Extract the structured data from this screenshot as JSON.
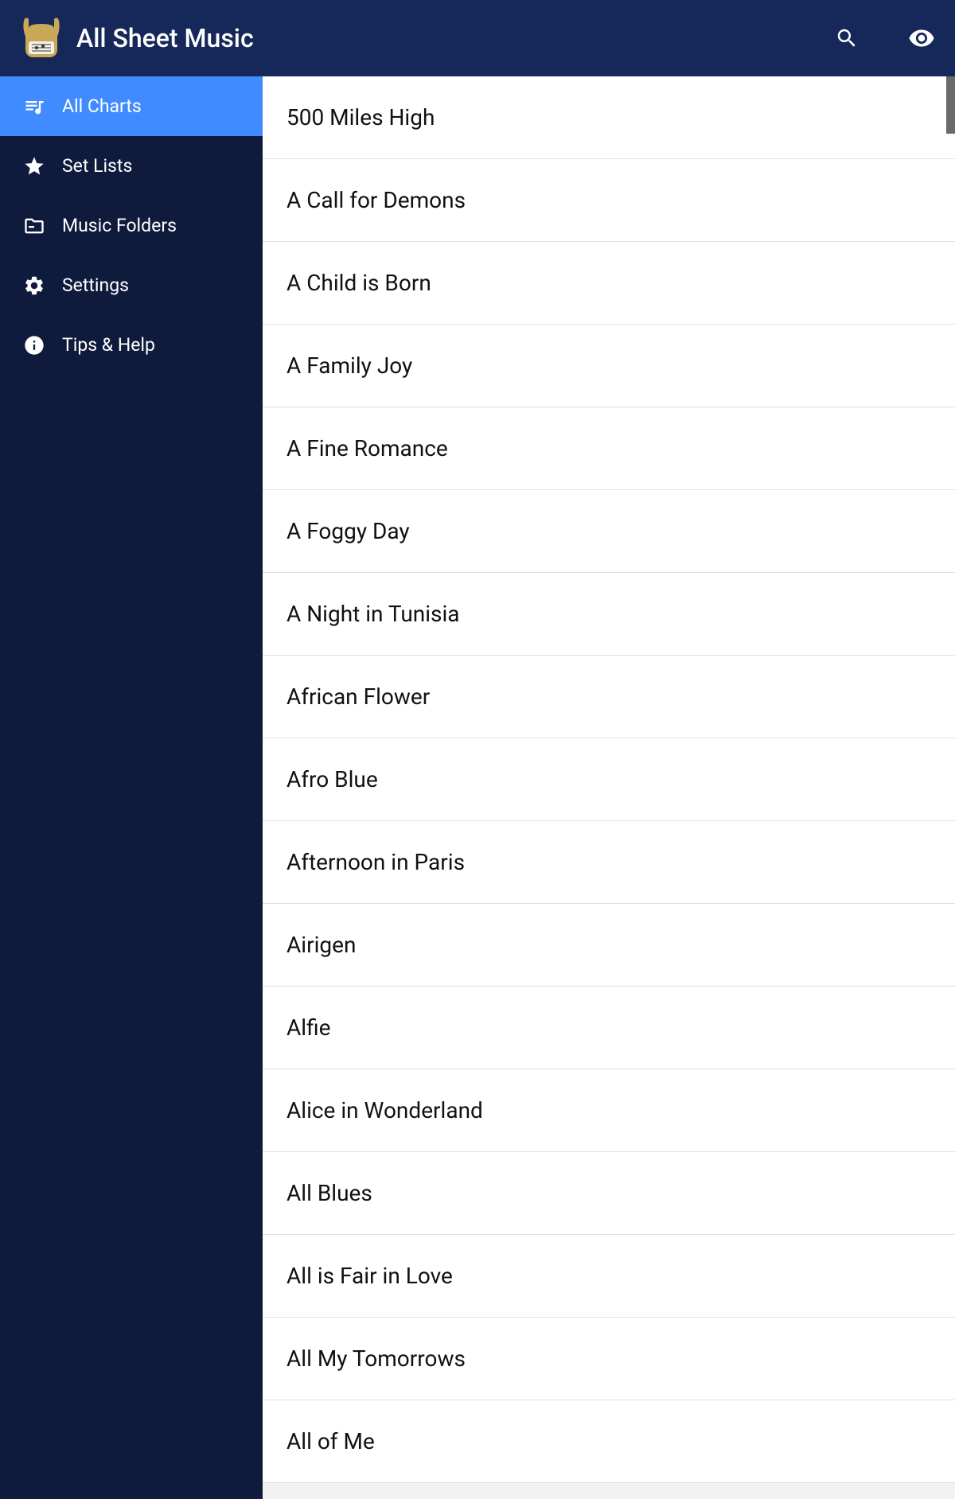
{
  "header": {
    "title": "All Sheet Music"
  },
  "sidebar": {
    "items": [
      {
        "label": "All Charts",
        "icon": "queue-music-icon",
        "active": true
      },
      {
        "label": "Set Lists",
        "icon": "star-icon",
        "active": false
      },
      {
        "label": "Music Folders",
        "icon": "folder-icon",
        "active": false
      },
      {
        "label": "Settings",
        "icon": "gear-icon",
        "active": false
      },
      {
        "label": "Tips & Help",
        "icon": "info-icon",
        "active": false
      }
    ]
  },
  "songs": [
    "500 Miles High",
    "A Call for Demons",
    "A Child is Born",
    "A Family Joy",
    "A Fine Romance",
    "A Foggy Day",
    "A Night in Tunisia",
    "African Flower",
    "Afro Blue",
    "Afternoon in Paris",
    "Airigen",
    "Alfie",
    "Alice in Wonderland",
    "All Blues",
    "All is Fair in Love",
    "All My Tomorrows",
    "All of Me"
  ]
}
